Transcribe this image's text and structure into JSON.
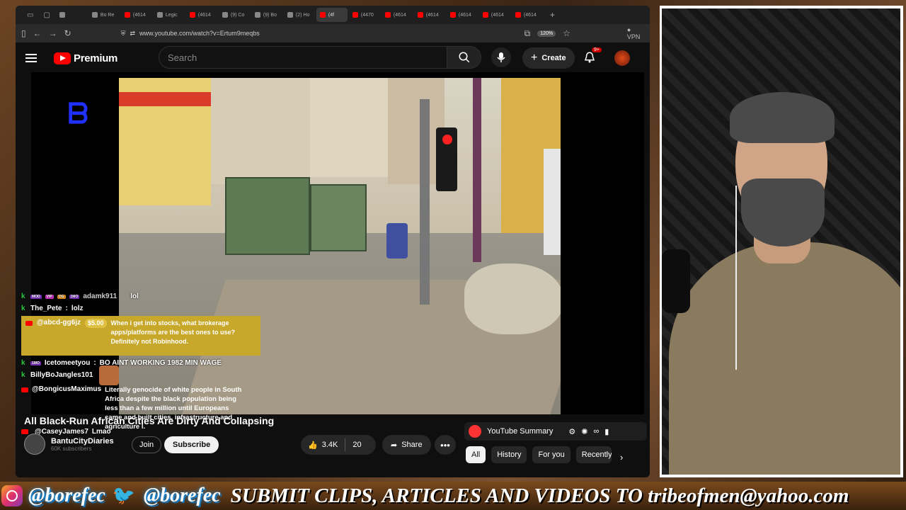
{
  "browser": {
    "tabs": [
      {
        "label": "",
        "color": "#888888"
      },
      {
        "label": "Bo Re",
        "color": "#888888"
      },
      {
        "label": "(4614",
        "color": "#ff0000"
      },
      {
        "label": "Legic",
        "color": "#888888"
      },
      {
        "label": "(4614",
        "color": "#ff0000"
      },
      {
        "label": "(9) Co",
        "color": "#888888"
      },
      {
        "label": "(9) Bo",
        "color": "#888888"
      },
      {
        "label": "(2) Ho",
        "color": "#888888"
      },
      {
        "label": "(4f",
        "color": "#ff0000"
      },
      {
        "label": "(4470",
        "color": "#ff0000"
      },
      {
        "label": "(4614",
        "color": "#ff0000"
      },
      {
        "label": "(4614",
        "color": "#ff0000"
      },
      {
        "label": "(4614",
        "color": "#ff0000"
      },
      {
        "label": "(4614",
        "color": "#ff0000"
      },
      {
        "label": "(4614",
        "color": "#ff0000"
      }
    ],
    "active_tab_index": 8,
    "url": "www.youtube.com/watch?v=Ertum9meqbs",
    "zoom": "120%",
    "vpn_label": "VPN"
  },
  "youtube": {
    "brand": "Premium",
    "search_placeholder": "Search",
    "create_label": "Create",
    "notif_count": "9+",
    "video": {
      "title": "All Black-Run African Cities Are Dirty And Collapsing",
      "channel": "BantuCityDiaries",
      "subs": "60K subscribers",
      "join_label": "Join",
      "subscribe_label": "Subscribe",
      "likes": "3.4K",
      "comments": "20",
      "share_label": "Share"
    },
    "summary_label": "YouTube Summary",
    "chips": [
      "All",
      "History",
      "For you",
      "Recently"
    ],
    "active_chip": 0
  },
  "chat": [
    {
      "name": "adamk911",
      "message": "lol",
      "source": "kick"
    },
    {
      "name": "The_Pete",
      "message": "lolz",
      "source": "kick"
    },
    {
      "name": "@abcd-gg6jz",
      "amount": "$5.00",
      "message": "When i get into stocks, what brokerage apps/platforms are the best ones to use? Definitely not Robinhood.",
      "source": "youtube",
      "superchat": true
    },
    {
      "name": "Icetomeetyou",
      "message": "BO AINT WORKING 1982 MIN WAGE",
      "source": "kick"
    },
    {
      "name": "BillyBoJangles101",
      "message": "",
      "source": "kick"
    },
    {
      "name": "@BongicusMaximus",
      "message": "Literally genocide of white people in South Africa despite the black population being less than a few million until Europeans came and built cities, infrastructure and agriculture l.",
      "source": "youtube"
    },
    {
      "name": "@CaseyJames7",
      "message": "Lmao",
      "source": "youtube"
    }
  ],
  "banner": {
    "instagram_handle": "@borefec",
    "twitter_handle": "@borefec",
    "submit_text": "SUBMIT CLIPS, ARTICLES AND VIDEOS TO tribeofmen@yahoo.com"
  },
  "colors": {
    "youtube_red": "#ff0000",
    "superchat_gold": "#c8a82a",
    "kick_green": "#2ecc40"
  }
}
